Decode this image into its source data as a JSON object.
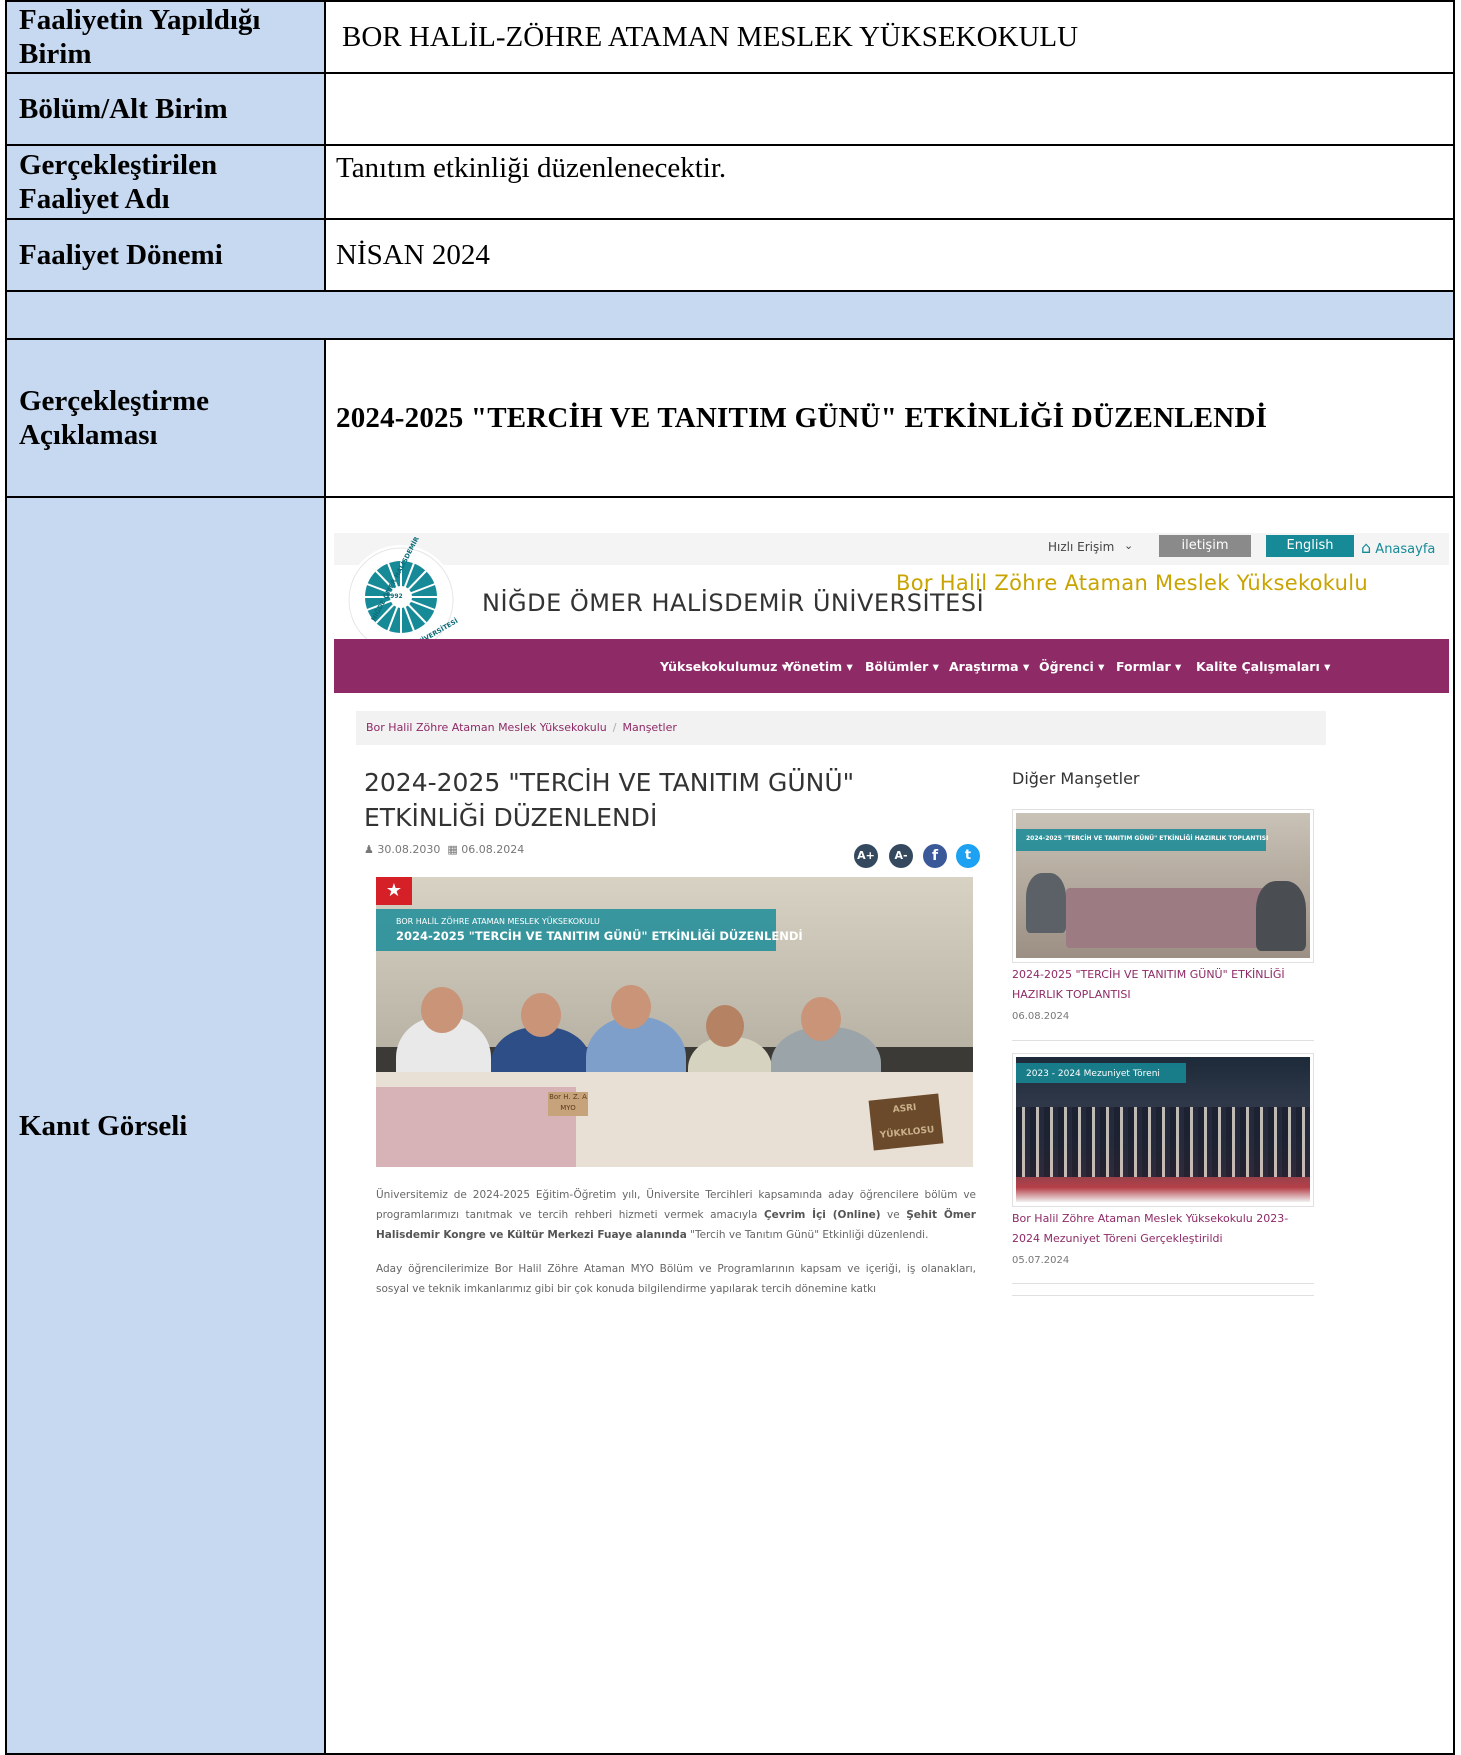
{
  "form": {
    "row1": {
      "label": "Faaliyetin Yapıldığı Birim",
      "value": "BOR HALİL-ZÖHRE ATAMAN MESLEK YÜKSEKOKULU"
    },
    "row2": {
      "label": "Bölüm/Alt Birim",
      "value": ""
    },
    "row3": {
      "label": "Gerçekleştirilen Faaliyet Adı",
      "value": "Tanıtım etkinliği düzenlenecektir."
    },
    "row4": {
      "label": "Faaliyet Dönemi",
      "value": "NİSAN 2024"
    },
    "row6": {
      "label": "Gerçekleştirme Açıklaması",
      "value": "2024-2025 \"TERCİH VE TANITIM GÜNÜ\" ETKİNLİĞİ DÜZENLENDİ"
    },
    "row7": {
      "label": "Kanıt Görseli"
    }
  },
  "screenshot": {
    "topbar": {
      "quick_access": "Hızlı Erişim",
      "contact": "iletişim",
      "english": "English",
      "home": "Anasayfa"
    },
    "logo_text": {
      "top": "NİĞDE ÖMER HALİSDEMİR",
      "bottom": "ÜNİVERSİTESİ",
      "year": "1992"
    },
    "university": "NİĞDE ÖMER HALİSDEMİR ÜNİVERSİTESİ",
    "school": "Bor Halil Zöhre Ataman Meslek Yüksekokulu",
    "nav": [
      "Yüksekokulumuz ▾",
      "Yönetim ▾",
      "Bölümler ▾",
      "Araştırma ▾",
      "Öğrenci ▾",
      "Formlar ▾",
      "Kalite Çalışmaları ▾"
    ],
    "breadcrumb": {
      "home": "Bor Halil Zöhre Ataman Meslek Yüksekokulu",
      "current": "Manşetler"
    },
    "article": {
      "title": "2024-2025 \"TERCİH VE TANITIM GÜNÜ\" ETKİNLİĞİ DÜZENLENDİ",
      "date1": "30.08.2030",
      "date2": "06.08.2024",
      "hero_flag": "★",
      "hero_banner_small": "BOR HALİL ZÖHRE ATAMAN MESLEK YÜKSEKOKULU",
      "hero_banner_big": "2024-2025 \"TERCİH VE TANITIM GÜNÜ\" ETKİNLİĞİ DÜZENLENDİ",
      "hero_sign": "Bor H. Z. A MYO",
      "hero_wood": "ASRI YÜKKLOSU",
      "para1_a": "Üniversitemiz de 2024-2025 Eğitim-Öğretim yılı, Üniversite Tercihleri kapsamında aday öğrencilere bölüm ve programlarımızı tanıtmak ve tercih rehberi hizmeti vermek amacıyla ",
      "para1_b": "Çevrim İçi (Online)",
      "para1_c": " ve ",
      "para1_d": "Şehit Ömer Halisdemir Kongre ve Kültür Merkezi Fuaye alanında",
      "para1_e": " \"Tercih ve Tanıtım Günü\" Etkinliği düzenlendi.",
      "para2": "Aday öğrencilerimize Bor Halil Zöhre Ataman MYO Bölüm ve Programlarının kapsam ve içeriği, iş olanakları, sosyal ve teknik imkanlarımız gibi bir çok konuda bilgilendirme yapılarak tercih dönemine katkı"
    },
    "social": {
      "font_up": "A+",
      "font_down": "A-",
      "facebook": "f",
      "twitter": "t"
    },
    "sidebar": {
      "title": "Diğer Manşetler",
      "items": [
        {
          "banner": "2024-2025 \"TERCİH VE TANITIM GÜNÜ\" ETKİNLİĞİ HAZIRLIK TOPLANTISI",
          "title": "2024-2025 \"TERCİH VE TANITIM GÜNÜ\" ETKİNLİĞİ HAZIRLIK TOPLANTISI",
          "date": "06.08.2024"
        },
        {
          "banner": "2023 - 2024 Mezuniyet Töreni",
          "title": "Bor Halil Zöhre Ataman Meslek Yüksekokulu 2023-2024 Mezuniyet Töreni Gerçekleştirildi",
          "date": "05.07.2024"
        }
      ]
    },
    "colors": {
      "brand_purple": "#8e2a66",
      "teal": "#168a97",
      "gold": "#c9a400",
      "label_blue": "#c6d9f1"
    }
  }
}
